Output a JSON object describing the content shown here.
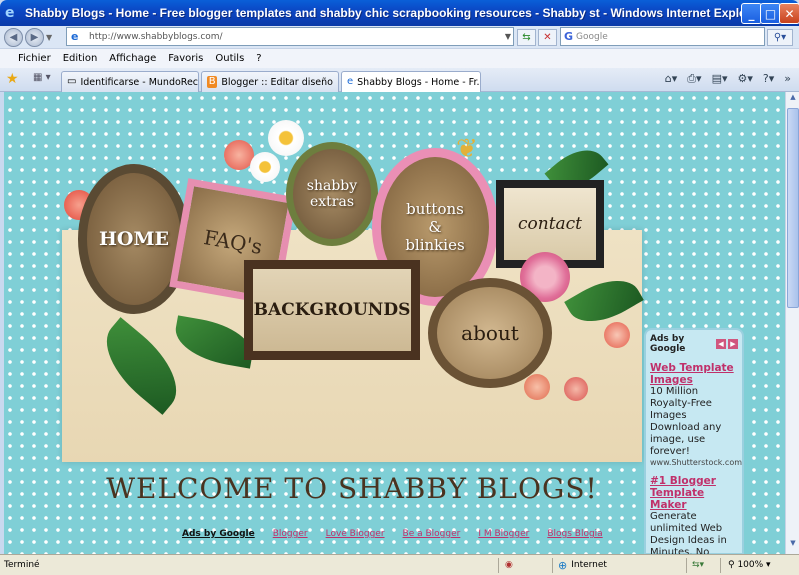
{
  "window": {
    "title": "Shabby Blogs - Home - Free blogger templates and shabby chic scrapbooking resources - Shabby st - Windows Internet Explorer",
    "min": "_",
    "max": "□",
    "close": "✕"
  },
  "address_bar": {
    "url": "http://www.shabbyblogs.com/"
  },
  "search": {
    "placeholder": "Google"
  },
  "menu": [
    "Fichier",
    "Edition",
    "Affichage",
    "Favoris",
    "Outils",
    "?"
  ],
  "tabs": [
    {
      "label": "Identificarse - MundoReceta...",
      "active": false
    },
    {
      "label": "Blogger :: Editar diseño",
      "active": false
    },
    {
      "label": "Shabby Blogs - Home - Fr...",
      "active": true
    }
  ],
  "page": {
    "nav": {
      "home": "HOME",
      "faqs": "FAQ's",
      "extras_1": "shabby",
      "extras_2": "extras",
      "buttons_1": "buttons",
      "buttons_2": "&",
      "buttons_3": "blinkies",
      "contact": "contact",
      "backgrounds": "BACKGROUNDS",
      "about": "about"
    },
    "welcome": "WELCOME TO SHABBY BLOGS!",
    "ad_links": {
      "label": "Ads by Google",
      "items": [
        "Blogger",
        "Love Blogger",
        "Be a Blogger",
        "I M Blogger",
        "Blogs Blogia"
      ]
    },
    "side_ads": {
      "label": "Ads by Google",
      "ads": [
        {
          "title": "Web Template Images",
          "desc": "10 Million Royalty-Free Images Download any image, use forever!",
          "url": "www.Shutterstock.com"
        },
        {
          "title": "#1 Blogger Template Maker",
          "desc": "Generate unlimited Web Design Ideas in Minutes. No Technical Skills!",
          "url": ""
        }
      ]
    }
  },
  "status": {
    "text": "Terminé",
    "zone": "Internet",
    "zoom": "100%"
  }
}
